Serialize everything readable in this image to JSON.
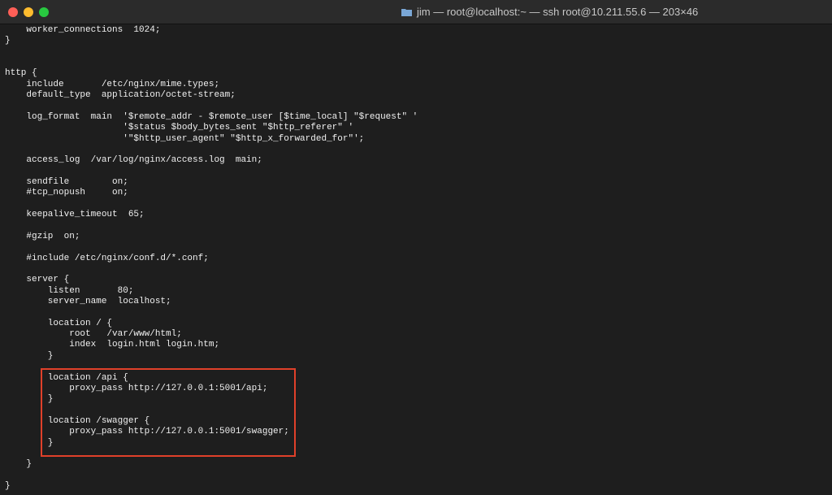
{
  "window": {
    "title": "jim — root@localhost:~ — ssh root@10.211.55.6 — 203×46"
  },
  "terminal": {
    "lines": [
      "    worker_connections  1024;",
      "}",
      "",
      "",
      "http {",
      "    include       /etc/nginx/mime.types;",
      "    default_type  application/octet-stream;",
      "",
      "    log_format  main  '$remote_addr - $remote_user [$time_local] \"$request\" '",
      "                      '$status $body_bytes_sent \"$http_referer\" '",
      "                      '\"$http_user_agent\" \"$http_x_forwarded_for\"';",
      "",
      "    access_log  /var/log/nginx/access.log  main;",
      "",
      "    sendfile        on;",
      "    #tcp_nopush     on;",
      "",
      "    keepalive_timeout  65;",
      "",
      "    #gzip  on;",
      "",
      "    #include /etc/nginx/conf.d/*.conf;",
      "",
      "    server {",
      "        listen       80;",
      "        server_name  localhost;",
      "",
      "        location / {",
      "            root   /var/www/html;",
      "            index  login.html login.htm;",
      "        }",
      "",
      "        location /api {",
      "            proxy_pass http://127.0.0.1:5001/api;",
      "        }",
      "",
      "        location /swagger {",
      "            proxy_pass http://127.0.0.1:5001/swagger;",
      "        }",
      "",
      "    }",
      "",
      "}"
    ]
  },
  "colors": {
    "highlight": "#e0402a",
    "background": "#1e1e1e",
    "text": "#f0f0f0"
  }
}
